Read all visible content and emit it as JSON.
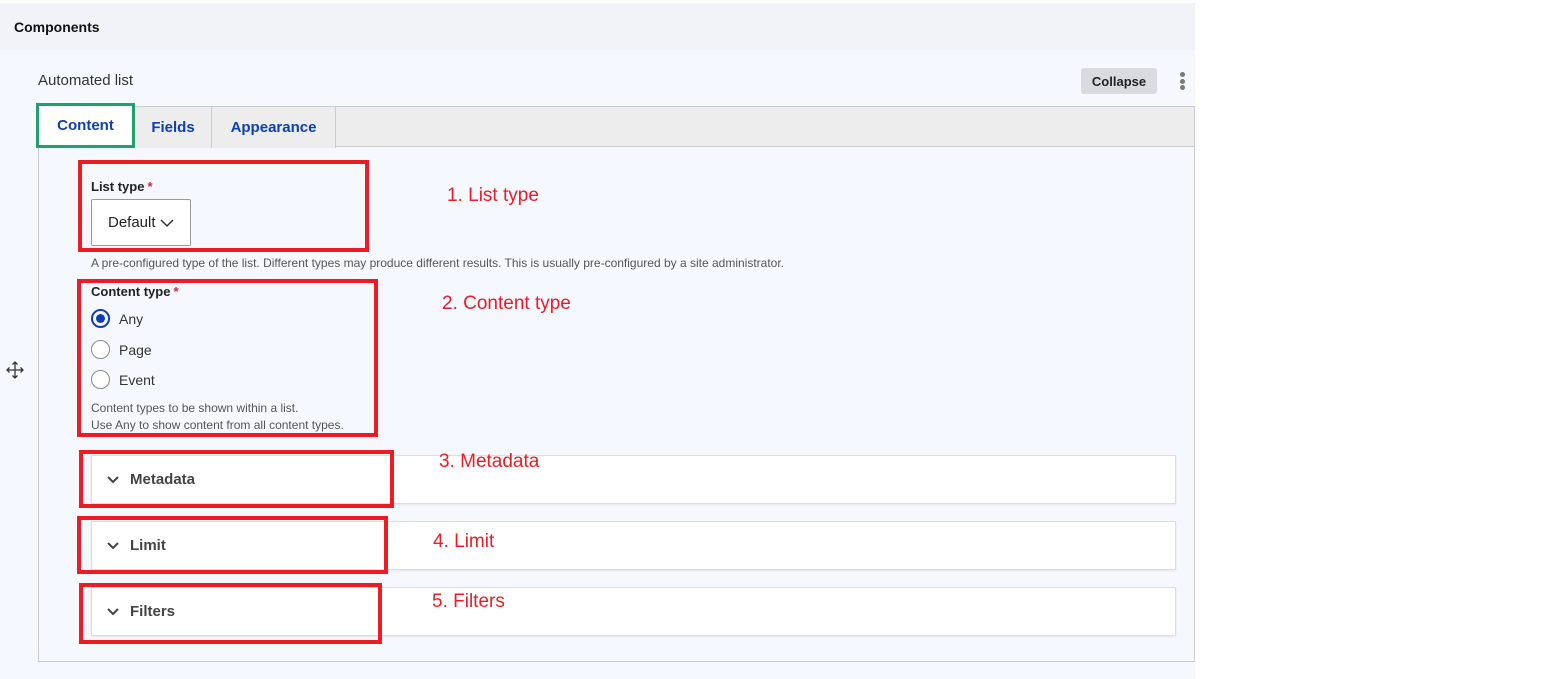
{
  "header": {
    "title": "Components"
  },
  "component": {
    "title": "Automated list",
    "collapse_label": "Collapse"
  },
  "tabs": [
    {
      "label": "Content"
    },
    {
      "label": "Fields"
    },
    {
      "label": "Appearance"
    }
  ],
  "list_type": {
    "label": "List type",
    "required": "*",
    "value": "Default",
    "description": "A pre-configured type of the list. Different types may produce different results. This is usually pre-configured by a site administrator."
  },
  "content_type": {
    "label": "Content type",
    "required": "*",
    "options": [
      {
        "label": "Any",
        "checked": true
      },
      {
        "label": "Page",
        "checked": false
      },
      {
        "label": "Event",
        "checked": false
      }
    ],
    "description_1": "Content types to be shown within a list.",
    "description_2": "Use Any to show content from all content types."
  },
  "sections": [
    {
      "label": "Metadata"
    },
    {
      "label": "Limit"
    },
    {
      "label": "Filters"
    }
  ],
  "annotations": [
    "1. List type",
    "2. Content type",
    "3. Metadata",
    "4. Limit",
    "5. Filters"
  ],
  "colors": {
    "annotation": "#ed1c24",
    "active_tab_outline": "#22a06b",
    "link": "#0b3fb8"
  }
}
